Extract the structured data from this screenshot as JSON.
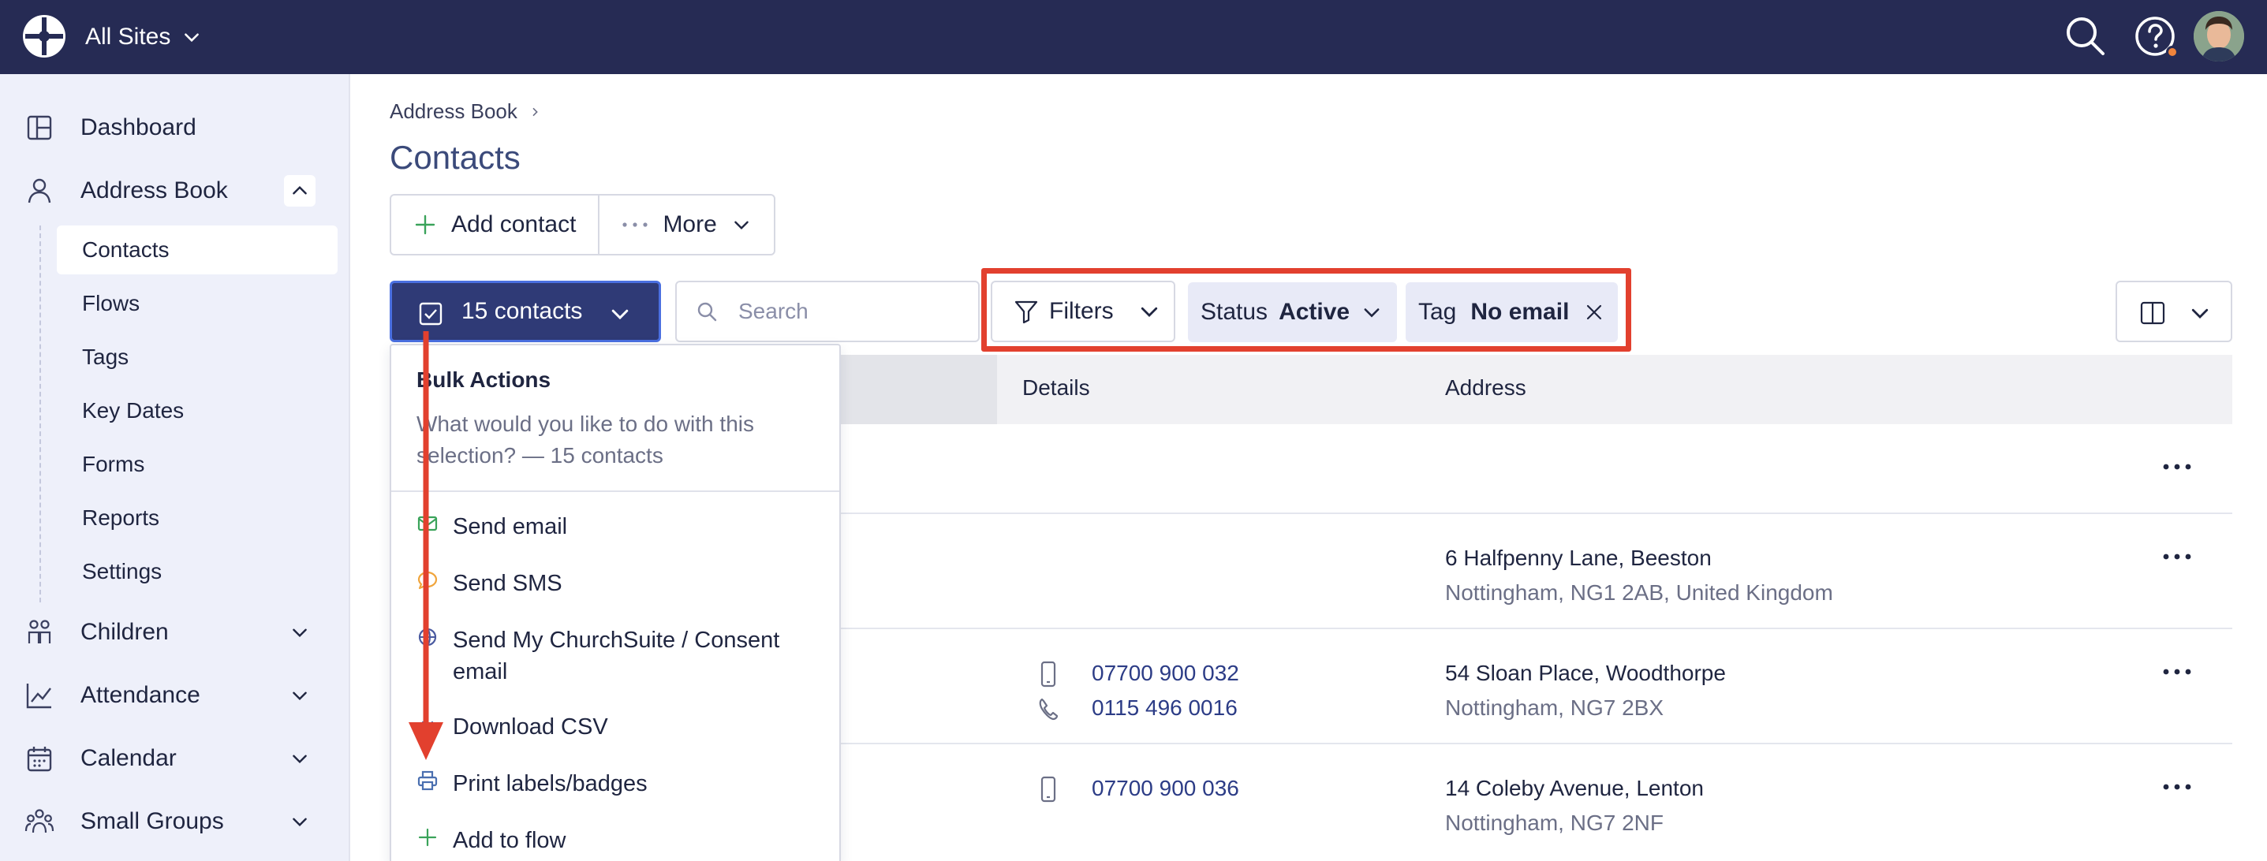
{
  "topbar": {
    "site_label": "All Sites",
    "icons": [
      "logo-icon",
      "search-icon",
      "help-icon",
      "user-avatar"
    ]
  },
  "sidebar": {
    "items": [
      {
        "label": "Dashboard",
        "icon": "dashboard-icon"
      },
      {
        "label": "Address Book",
        "icon": "person-icon",
        "expanded": true
      },
      {
        "label": "Children",
        "icon": "children-icon"
      },
      {
        "label": "Attendance",
        "icon": "chart-icon"
      },
      {
        "label": "Calendar",
        "icon": "calendar-icon"
      },
      {
        "label": "Small Groups",
        "icon": "group-icon"
      }
    ],
    "subitems": [
      "Contacts",
      "Flows",
      "Tags",
      "Key Dates",
      "Forms",
      "Reports",
      "Settings"
    ],
    "active_subitem": "Contacts"
  },
  "breadcrumb": {
    "item": "Address Book"
  },
  "page": {
    "title": "Contacts"
  },
  "toolbar": {
    "add_contact": "Add contact",
    "more": "More"
  },
  "selection": {
    "label": "15 contacts"
  },
  "search": {
    "placeholder": "Search",
    "value": ""
  },
  "filters": {
    "label": "Filters",
    "status_key": "Status",
    "status_value": "Active",
    "tag_key": "Tag",
    "tag_value": "No email"
  },
  "table": {
    "headers": {
      "details": "Details",
      "address": "Address"
    },
    "rows": [
      {
        "phones": [],
        "address_line1": "",
        "address_line2": ""
      },
      {
        "phones": [],
        "address_line1": "6 Halfpenny Lane, Beeston",
        "address_line2": "Nottingham, NG1 2AB, United Kingdom"
      },
      {
        "phones": [
          {
            "type": "mobile",
            "number": "07700 900 032"
          },
          {
            "type": "landline",
            "number": "0115 496 0016"
          }
        ],
        "address_line1": "54 Sloan Place, Woodthorpe",
        "address_line2": "Nottingham, NG7 2BX"
      },
      {
        "phones": [
          {
            "type": "mobile",
            "number": "07700 900 036"
          }
        ],
        "address_line1": "14 Coleby Avenue, Lenton",
        "address_line2": "Nottingham, NG7 2NF"
      }
    ]
  },
  "bulk_actions": {
    "title": "Bulk Actions",
    "description": "What would you like to do with this selection? — 15 contacts",
    "items": [
      {
        "label": "Send email",
        "icon": "email-icon",
        "color": "#3aa35a"
      },
      {
        "label": "Send SMS",
        "icon": "sms-icon",
        "color": "#f0a53c"
      },
      {
        "label": "Send My ChurchSuite / Consent email",
        "icon": "globe-icon",
        "color": "#4a5aa0"
      },
      {
        "label": "Download CSV",
        "icon": "download-icon",
        "color": "#4a5aa0"
      },
      {
        "label": "Print labels/badges",
        "icon": "print-icon",
        "color": "#4a6fb0"
      },
      {
        "label": "Add to flow",
        "icon": "plus-icon",
        "color": "#3aa35a"
      }
    ]
  },
  "colors": {
    "topbar": "#262b54",
    "sidebar": "#eef0fa",
    "primary_button": "#2f3a76",
    "annotation_red": "#e2402e",
    "link": "#2c3c86"
  }
}
